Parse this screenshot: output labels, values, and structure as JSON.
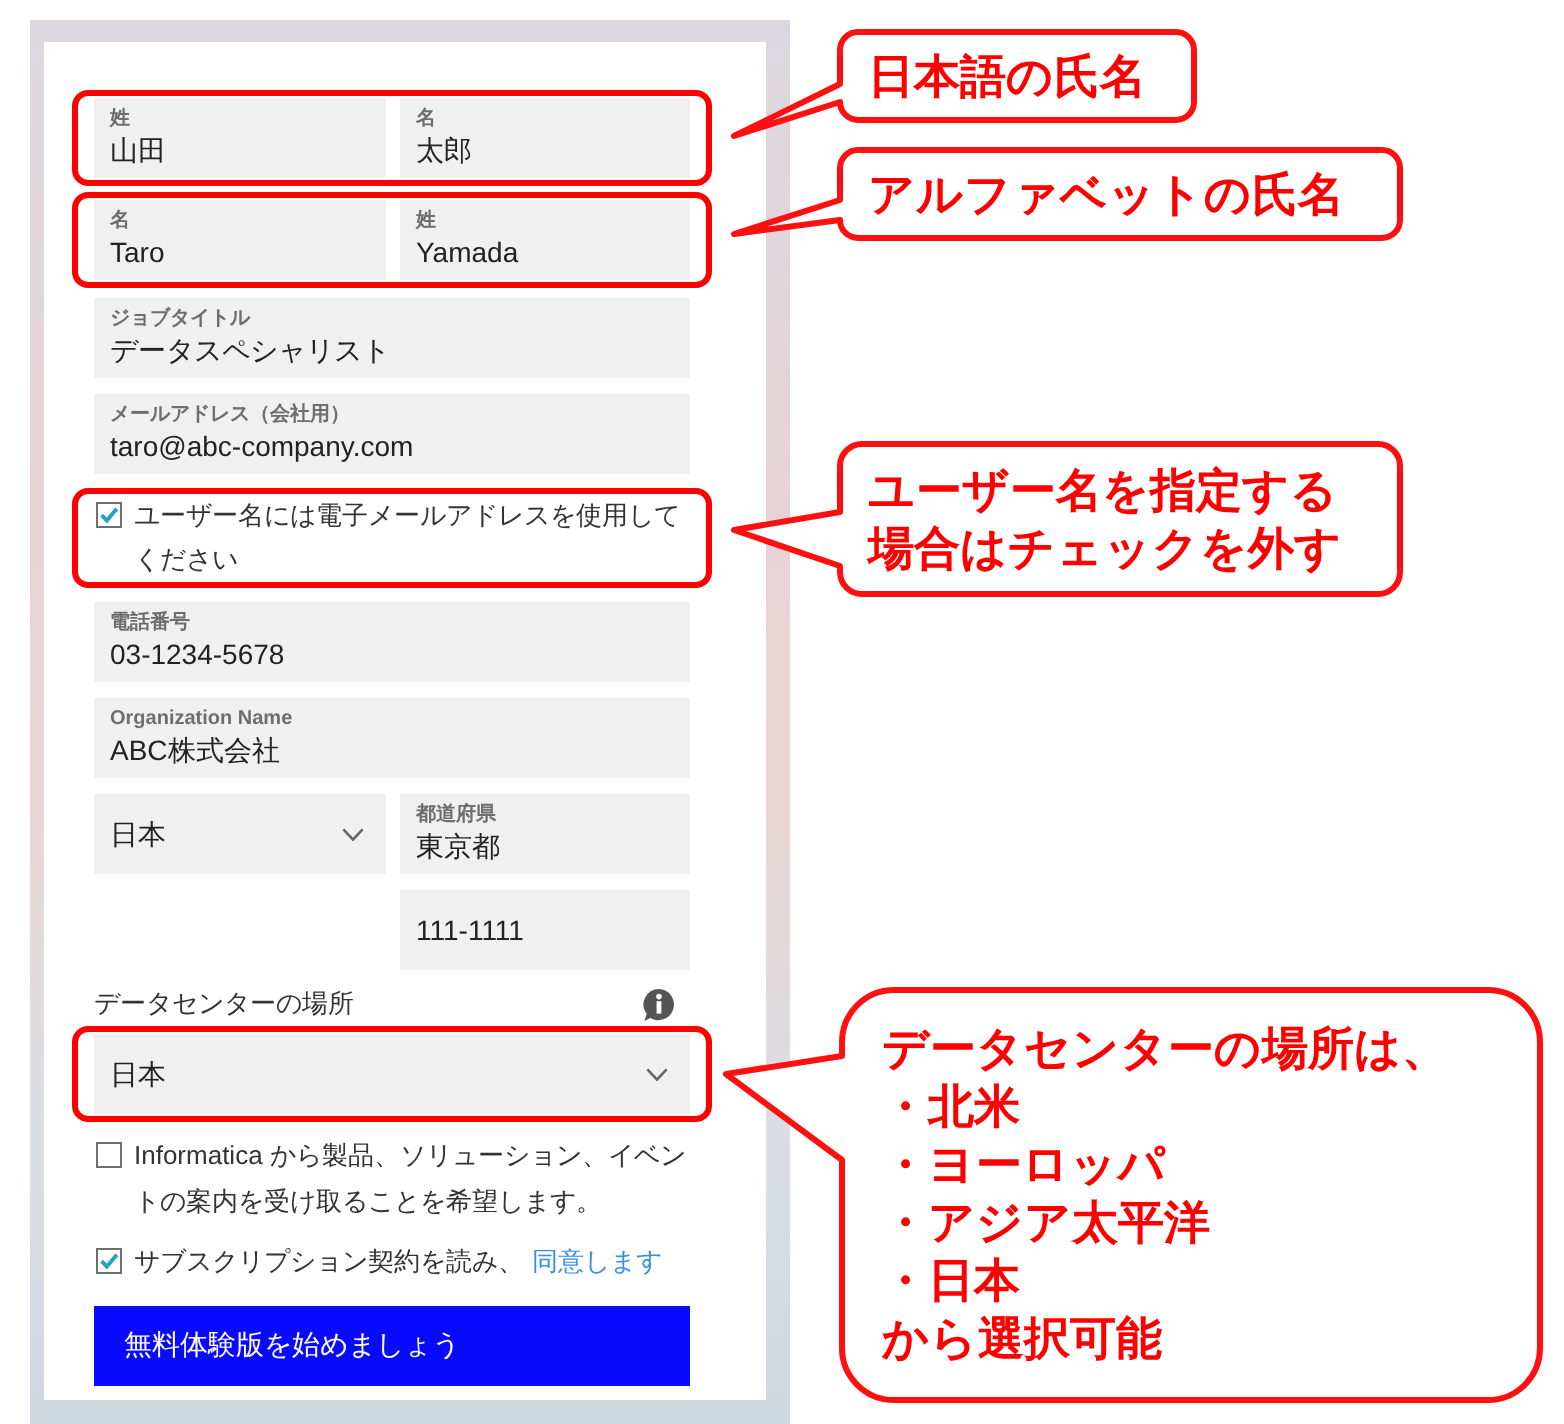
{
  "form": {
    "items": [
      {
        "kind": "fields",
        "highlighted": true,
        "fields": [
          {
            "kind": "text",
            "label": "姓",
            "value": "山田"
          },
          {
            "kind": "text",
            "label": "名",
            "value": "太郎"
          }
        ]
      },
      {
        "kind": "fields",
        "highlighted": true,
        "fields": [
          {
            "kind": "text",
            "label": "名",
            "value": "Taro"
          },
          {
            "kind": "text",
            "label": "姓",
            "value": "Yamada"
          }
        ]
      },
      {
        "kind": "fields",
        "highlighted": false,
        "fields": [
          {
            "kind": "text",
            "label": "ジョブタイトル",
            "value": "データスペシャリスト"
          }
        ]
      },
      {
        "kind": "fields",
        "highlighted": false,
        "fields": [
          {
            "kind": "text",
            "label": "メールアドレス（会社用）",
            "value": "taro@abc-company.com"
          }
        ]
      },
      {
        "kind": "checkbox",
        "highlighted": true,
        "checked": true,
        "text": "ユーザー名には電子メールアドレスを使用してください"
      },
      {
        "kind": "fields",
        "highlighted": false,
        "fields": [
          {
            "kind": "text",
            "label": "電話番号",
            "value": "03-1234-5678"
          }
        ]
      },
      {
        "kind": "fields",
        "highlighted": false,
        "fields": [
          {
            "kind": "text",
            "label": "Organization Name",
            "value": "ABC株式会社"
          }
        ]
      },
      {
        "kind": "fields",
        "highlighted": false,
        "fields": [
          {
            "kind": "select",
            "value": "日本"
          },
          {
            "kind": "text",
            "label": "都道府県",
            "value": "東京都"
          },
          {
            "kind": "text",
            "value": "111-1111"
          }
        ]
      },
      {
        "kind": "heading",
        "text": "データセンターの場所"
      },
      {
        "kind": "select",
        "highlighted": true,
        "value": "日本"
      },
      {
        "kind": "checkbox",
        "highlighted": false,
        "checked": false,
        "text": "Informatica から製品、ソリューション、イベントの案内を受け取ることを希望します。"
      },
      {
        "kind": "checkbox",
        "highlighted": false,
        "checked": true,
        "text": "サブスクリプション契約を読み、",
        "link": "同意します"
      },
      {
        "kind": "button",
        "label": "無料体験版を始めましょう"
      }
    ]
  },
  "callouts": [
    {
      "text": "日本語の氏名"
    },
    {
      "text": "アルファベットの氏名"
    },
    {
      "text": "ユーザー名を指定する場合はチェックを外す"
    },
    {
      "lines": [
        "データセンターの場所は、",
        "・北米",
        "・ヨーロッパ",
        "・アジア太平洋",
        "・日本",
        "から選択可能"
      ]
    }
  ]
}
